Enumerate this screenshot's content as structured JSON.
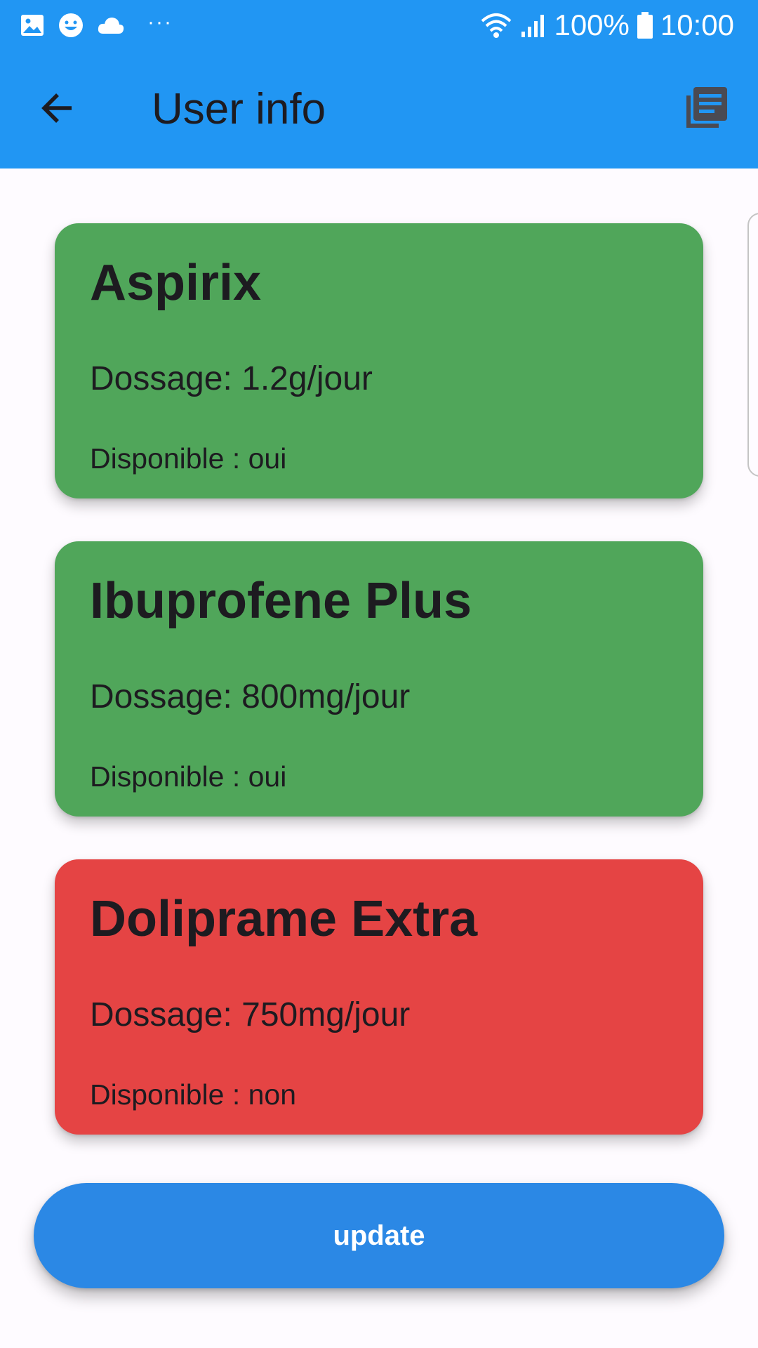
{
  "status_bar": {
    "left_icons": [
      "gallery-icon",
      "smiley-icon",
      "cloud-icon"
    ],
    "overflow": "···",
    "right_icons": [
      "wifi-icon",
      "signal-icon",
      "battery-icon"
    ],
    "battery": "100%",
    "time": "10:00"
  },
  "app_bar": {
    "title": "User info",
    "back_icon": "arrow-back-icon",
    "action_icon": "library-books-icon",
    "background": "#2196f3"
  },
  "medications": [
    {
      "name": "Aspirix",
      "dosage": "Dossage: 1.2g/jour",
      "available": "Disponible : oui",
      "color": "#50a65a"
    },
    {
      "name": "Ibuprofene Plus",
      "dosage": "Dossage: 800mg/jour",
      "available": "Disponible : oui",
      "color": "#50a65a"
    },
    {
      "name": "Doliprame Extra",
      "dosage": "Dossage: 750mg/jour",
      "available": "Disponible : non",
      "color": "#e54444"
    }
  ],
  "update_button": {
    "label": "update",
    "color": "#2b88e5"
  }
}
